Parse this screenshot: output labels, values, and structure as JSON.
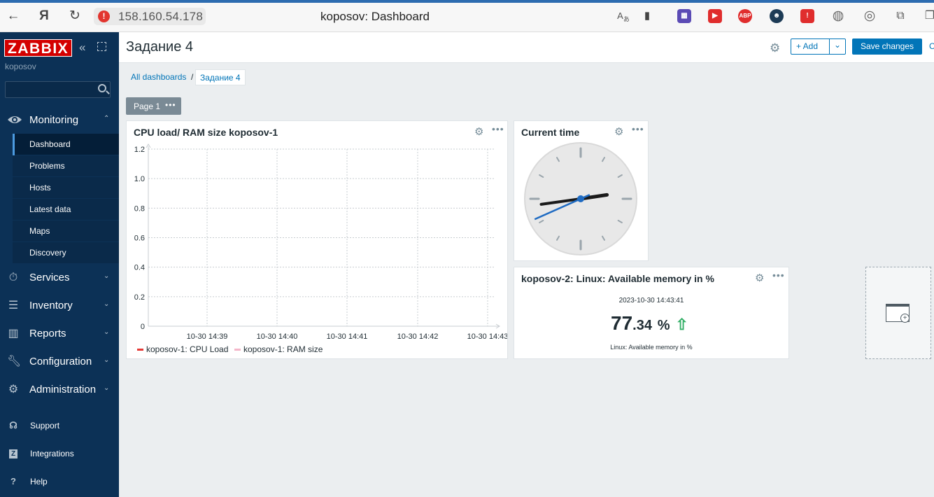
{
  "browser": {
    "url": "158.160.54.178",
    "tab_title": "koposov: Dashboard"
  },
  "sidebar": {
    "logo": "ZABBIX",
    "user": "koposov",
    "search_placeholder": "",
    "monitoring": {
      "label": "Monitoring",
      "items": [
        "Dashboard",
        "Problems",
        "Hosts",
        "Latest data",
        "Maps",
        "Discovery"
      ],
      "active": "Dashboard"
    },
    "menu": [
      {
        "label": "Services",
        "icon": "services-icon"
      },
      {
        "label": "Inventory",
        "icon": "inventory-icon"
      },
      {
        "label": "Reports",
        "icon": "reports-icon"
      },
      {
        "label": "Configuration",
        "icon": "configuration-icon"
      },
      {
        "label": "Administration",
        "icon": "administration-icon"
      }
    ],
    "bottom": [
      {
        "label": "Support",
        "icon": "support-icon"
      },
      {
        "label": "Integrations",
        "icon": "integrations-icon"
      },
      {
        "label": "Help",
        "icon": "help-icon"
      }
    ]
  },
  "header": {
    "title": "Задание 4",
    "add_label": "+ Add",
    "save_label": "Save changes",
    "cancel_label": "C"
  },
  "breadcrumb": {
    "parent": "All dashboards",
    "separator": "/",
    "current": "Задание 4"
  },
  "pages": {
    "current": "Page 1",
    "menu": "•••"
  },
  "widgets": {
    "graph": {
      "title": "CPU load/ RAM size koposov-1",
      "menu": "•••",
      "legend": [
        {
          "label": "koposov-1: CPU Load",
          "color": "#e53935"
        },
        {
          "label": "koposov-1: RAM size",
          "color": "#f4b6c9"
        }
      ]
    },
    "clock": {
      "title": "Current time",
      "menu": "•••",
      "time": "14:43:41"
    },
    "item": {
      "title": "koposov-2: Linux: Available memory in %",
      "menu": "•••",
      "timestamp": "2023-10-30 14:43:41",
      "value_int": "77",
      "value_dec": ".34",
      "unit": "%",
      "trend": "up",
      "description": "Linux: Available memory in %"
    }
  },
  "chart_data": {
    "type": "line",
    "title": "CPU load/ RAM size koposov-1",
    "x": [
      "10-30 14:39",
      "10-30 14:40",
      "10-30 14:41",
      "10-30 14:42",
      "10-30 14:43"
    ],
    "yticks": [
      "1.2",
      "1.0",
      "0.8",
      "0.6",
      "0.4",
      "0.2",
      "0"
    ],
    "ylim": [
      0,
      1.2
    ],
    "grid": true,
    "legend_position": "bottom",
    "series": [
      {
        "name": "koposov-1: CPU Load",
        "values": []
      },
      {
        "name": "koposov-1: RAM size",
        "values": []
      }
    ]
  },
  "colors": {
    "sidebar_bg": "#0c3156",
    "accent": "#0275b8",
    "logo_red": "#d40000",
    "trend_up": "#34af67",
    "clock_hand": "#1f6bc2"
  }
}
